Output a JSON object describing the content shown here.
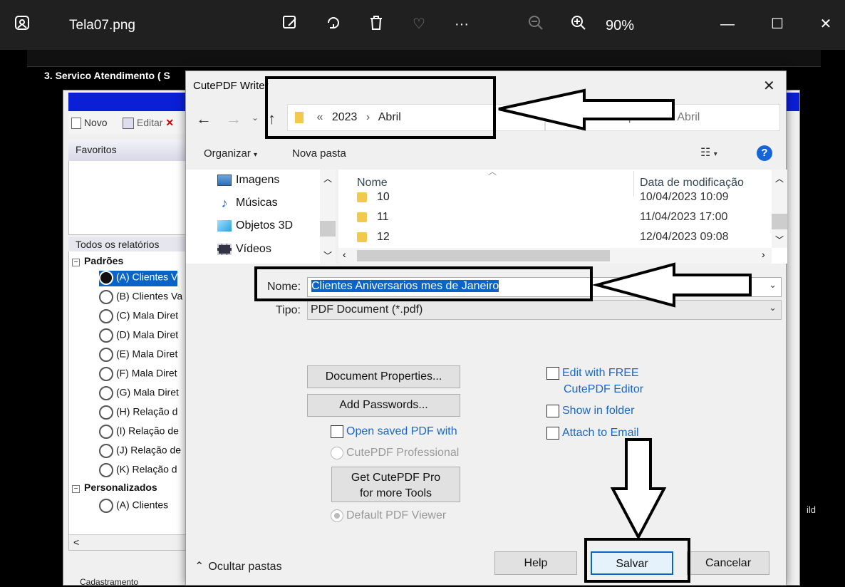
{
  "viewer": {
    "filename": "Tela07.png",
    "zoom": "90%",
    "icons": [
      "photo-icon",
      "edit-icon",
      "rotate-icon",
      "delete-icon",
      "favorite-icon",
      "more-icon",
      "zoom-out-icon",
      "zoom-in-icon",
      "minimize-icon",
      "maximize-icon",
      "close-icon"
    ]
  },
  "background_app": {
    "title": "3. Servico Atendimento ( S",
    "toolbar": {
      "new_label": "Novo",
      "edit_label": "Editar"
    },
    "favorites_header": "Favoritos",
    "all_reports_header": "Todos os relatórios",
    "tree": {
      "group_standard": "Padrões",
      "standard_items": [
        "(A) Clientes V",
        "(B) Clientes Va",
        "(C) Mala Diret",
        "(D) Mala Diret",
        "(E) Mala Diret",
        "(F) Mala Diret",
        "(G) Mala Diret",
        "(H) Relação d",
        "(I) Relação de",
        "(J) Relação de",
        "(K) Relação d"
      ],
      "group_custom": "Personalizados",
      "custom_items": [
        "(A) Clientes"
      ]
    },
    "bottom_tab": "Cadastramento",
    "right_fragment": "ild"
  },
  "dialog": {
    "title": "CutePDF Writer",
    "breadcrumb": {
      "sep": "«",
      "parts": [
        "2023",
        "Abril"
      ]
    },
    "search_placeholder": "Pesquisar em Abril",
    "organize_label": "Organizar",
    "new_folder_label": "Nova pasta",
    "nav_items": [
      "Imagens",
      "Músicas",
      "Objetos 3D",
      "Vídeos"
    ],
    "columns": {
      "name": "Nome",
      "date": "Data de modificação"
    },
    "files": [
      {
        "name": "10",
        "date": "10/04/2023 10:09"
      },
      {
        "name": "11",
        "date": "11/04/2023 17:00"
      },
      {
        "name": "12",
        "date": "12/04/2023 09:08"
      }
    ],
    "filename_label": "Nome:",
    "filename_value": "Clientes Aniversarios mes de Janeiro",
    "type_label": "Tipo:",
    "type_value": "PDF Document (*.pdf)",
    "doc_props_btn": "Document Properties...",
    "add_passwords_btn": "Add Passwords...",
    "open_saved_label": "Open saved PDF with",
    "cutepdf_pro_label": "CutePDF Professional",
    "get_pro_btn_line1": "Get CutePDF Pro",
    "get_pro_btn_line2": "for more Tools",
    "default_viewer_label": "Default PDF Viewer",
    "edit_free_line1": "Edit with FREE",
    "edit_free_line2": "CutePDF Editor",
    "show_folder_label": "Show in folder",
    "attach_email_label": "Attach to Email",
    "hide_folders_label": "Ocultar pastas",
    "help_btn": "Help",
    "save_btn": "Salvar",
    "cancel_btn": "Cancelar"
  }
}
